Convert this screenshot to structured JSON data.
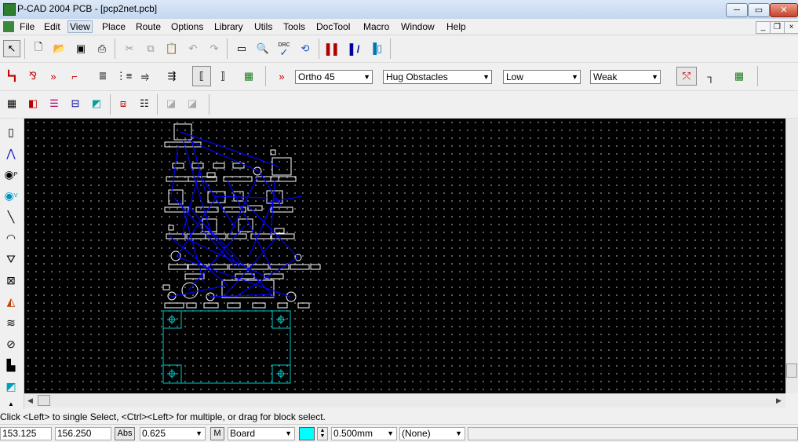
{
  "window": {
    "title": "P-CAD 2004 PCB - [pcp2net.pcb]",
    "controls": {
      "minimize": "─",
      "maximize": "▭",
      "close": "✕"
    },
    "mdi_controls": {
      "minimize": "_",
      "restore": "❐",
      "close": "×"
    }
  },
  "menu": {
    "items": [
      "File",
      "Edit",
      "View",
      "Place",
      "Route",
      "Options",
      "Library",
      "Utils",
      "Tools",
      "DocTool",
      "Macro",
      "Window",
      "Help"
    ],
    "active": "View"
  },
  "toolbar1": {
    "icons": [
      "select-arrow-icon",
      "new-file-icon",
      "open-folder-icon",
      "save-icon",
      "print-icon",
      "cut-icon",
      "copy-icon",
      "paste-icon",
      "undo-icon",
      "redo-icon",
      "measure-icon",
      "zoom-icon",
      "drc-icon",
      "net-refresh-icon",
      "layer-red-icon",
      "layer-blue-icon",
      "layer-mixed-icon"
    ],
    "drc_label": "DRC"
  },
  "toolbar2": {
    "icons": [
      "route-manual-icon",
      "route-multi-icon",
      "route-interactive-icon",
      "route-bus-icon",
      "route-miter-icon",
      "route-fanout-icon",
      "route-diff-icon",
      "route-push-icon",
      "route-hug-icon",
      "route-single-icon",
      "route-board-icon",
      "route-autonet-icon"
    ],
    "ortho": {
      "value": "Ortho 45"
    },
    "obstacles": {
      "value": "Hug Obstacles"
    },
    "optimize": {
      "value": "Low"
    },
    "strength": {
      "value": "Weak"
    },
    "right_icons": [
      "unroute-icon",
      "corner-icon",
      "chip-green-icon"
    ]
  },
  "toolbar3": {
    "icons": [
      "grid-table-icon",
      "layers-icon",
      "layer-stack-icon",
      "pad-icon",
      "place-color-icon",
      "select-rect-icon",
      "list-icon",
      "auto-route-icon",
      "reroute-icon"
    ]
  },
  "left_toolbar": {
    "icons": [
      "place-component-icon",
      "place-connection-icon",
      "place-pad-icon",
      "place-via-icon",
      "place-line-icon",
      "place-arc-icon",
      "place-polygon-icon",
      "place-cutout-icon",
      "place-copper-icon",
      "place-plane-icon",
      "keepout-icon",
      "place-text-icon",
      "place-field-icon",
      "point-icon"
    ],
    "pad_sub": "P",
    "via_sub": "V"
  },
  "status": {
    "message": "Click <Left> to single Select, <Ctrl><Left> for multiple, or drag for block select.",
    "x_coord": "153.125",
    "y_coord": "156.250",
    "abs_label": "Abs",
    "grid_value": "0.625",
    "m_label": "M",
    "layer_value": "Board",
    "layer_color": "#00ffff",
    "line_width": "0.500mm",
    "style_value": "(None)"
  },
  "colors": {
    "canvas": "#000000",
    "components": "#ffffff",
    "ratsnest": "#0000ff",
    "board_outline": "#00c8c8"
  }
}
